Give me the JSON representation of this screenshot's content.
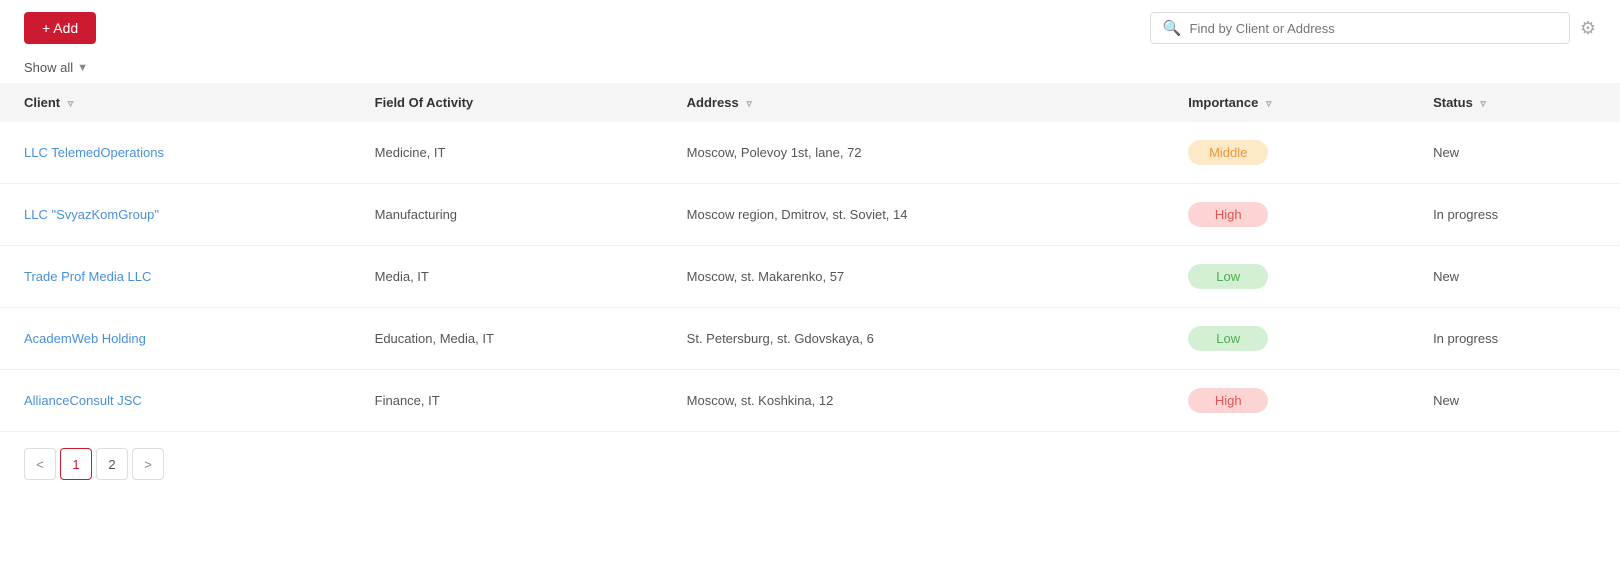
{
  "header": {
    "add_label": "+ Add",
    "search_placeholder": "Find by Client or Address"
  },
  "filter": {
    "show_all_label": "Show all"
  },
  "table": {
    "columns": [
      {
        "key": "client",
        "label": "Client",
        "filterable": true
      },
      {
        "key": "field",
        "label": "Field Of Activity",
        "filterable": false
      },
      {
        "key": "address",
        "label": "Address",
        "filterable": true
      },
      {
        "key": "importance",
        "label": "Importance",
        "filterable": true
      },
      {
        "key": "status",
        "label": "Status",
        "filterable": true
      }
    ],
    "rows": [
      {
        "client": "LLC TelemedOperations",
        "field": "Medicine, IT",
        "address": "Moscow, Polevoy 1st, lane, 72",
        "importance": "Middle",
        "importance_class": "badge-middle",
        "status": "New"
      },
      {
        "client": "LLC \"SvyazKomGroup\"",
        "field": "Manufacturing",
        "address": "Moscow region, Dmitrov, st. Soviet, 14",
        "importance": "High",
        "importance_class": "badge-high",
        "status": "In progress"
      },
      {
        "client": "Trade Prof Media LLC",
        "field": "Media, IT",
        "address": "Moscow, st. Makarenko, 57",
        "importance": "Low",
        "importance_class": "badge-low",
        "status": "New"
      },
      {
        "client": "AcademWeb Holding",
        "field": "Education, Media, IT",
        "address": "St. Petersburg, st. Gdovskaya, 6",
        "importance": "Low",
        "importance_class": "badge-low",
        "status": "In progress"
      },
      {
        "client": "AllianceConsult JSC",
        "field": "Finance, IT",
        "address": "Moscow, st. Koshkina, 12",
        "importance": "High",
        "importance_class": "badge-high",
        "status": "New"
      }
    ]
  },
  "pagination": {
    "prev_label": "<",
    "next_label": ">",
    "current_page": 1,
    "pages": [
      1,
      2
    ]
  }
}
